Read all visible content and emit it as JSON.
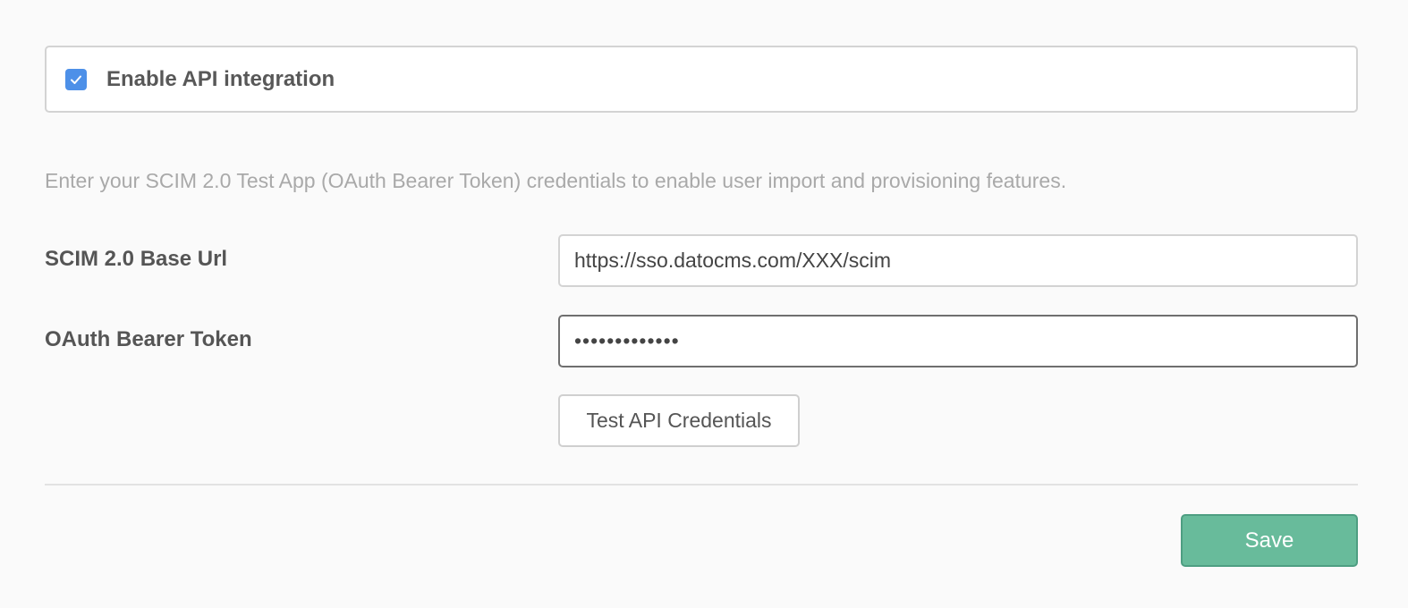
{
  "integration": {
    "checkbox_checked": true,
    "label": "Enable API integration",
    "check_icon": "checkmark-icon",
    "accent_color": "#4d90e8"
  },
  "helper_text": "Enter your SCIM 2.0 Test App (OAuth Bearer Token) credentials to enable user import and provisioning features.",
  "fields": {
    "base_url": {
      "label": "SCIM 2.0 Base Url",
      "value": "https://sso.datocms.com/XXX/scim"
    },
    "token": {
      "label": "OAuth Bearer Token",
      "value": "•••••••••••••"
    }
  },
  "buttons": {
    "test_label": "Test API Credentials",
    "save_label": "Save",
    "save_color": "#68bb9b"
  }
}
